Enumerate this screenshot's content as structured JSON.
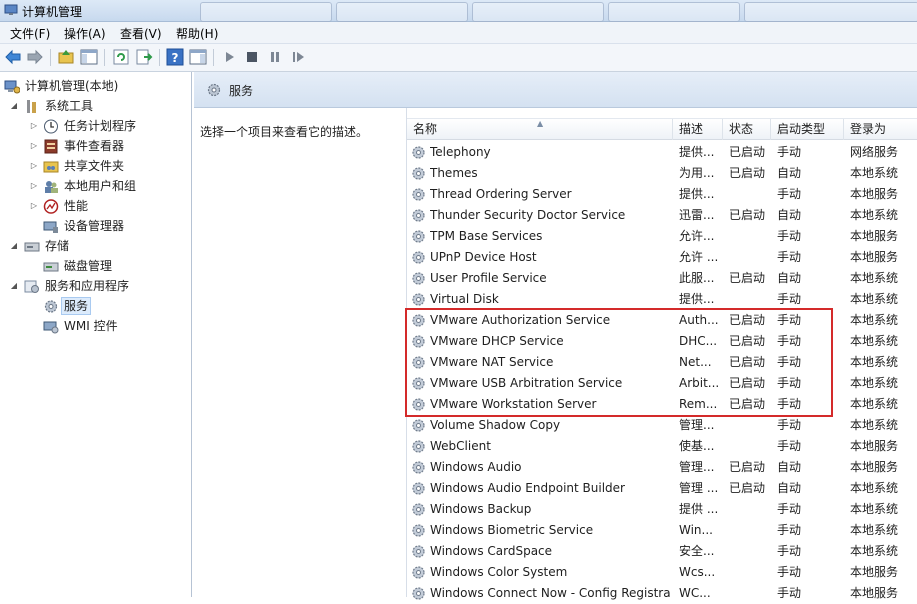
{
  "window": {
    "title": "计算机管理"
  },
  "menu": [
    "文件(F)",
    "操作(A)",
    "查看(V)",
    "帮助(H)"
  ],
  "tree": {
    "root": "计算机管理(本地)",
    "system_tools": "系统工具",
    "task_scheduler": "任务计划程序",
    "event_viewer": "事件查看器",
    "shared_folders": "共享文件夹",
    "local_users": "本地用户和组",
    "performance": "性能",
    "device_manager": "设备管理器",
    "storage": "存储",
    "disk_management": "磁盘管理",
    "services_apps": "服务和应用程序",
    "services": "服务",
    "wmi": "WMI 控件"
  },
  "main": {
    "header_title": "服务",
    "description_prompt": "选择一个项目来查看它的描述。"
  },
  "columns": {
    "name": "名称",
    "description": "描述",
    "status": "状态",
    "startup": "启动类型",
    "logon": "登录为"
  },
  "services": [
    {
      "name": "Telephony",
      "desc": "提供...",
      "status": "已启动",
      "startup": "手动",
      "logon": "网络服务"
    },
    {
      "name": "Themes",
      "desc": "为用...",
      "status": "已启动",
      "startup": "自动",
      "logon": "本地系统"
    },
    {
      "name": "Thread Ordering Server",
      "desc": "提供...",
      "status": "",
      "startup": "手动",
      "logon": "本地服务"
    },
    {
      "name": "Thunder Security Doctor Service",
      "desc": "迅雷...",
      "status": "已启动",
      "startup": "自动",
      "logon": "本地系统"
    },
    {
      "name": "TPM Base Services",
      "desc": "允许...",
      "status": "",
      "startup": "手动",
      "logon": "本地服务"
    },
    {
      "name": "UPnP Device Host",
      "desc": "允许 ...",
      "status": "",
      "startup": "手动",
      "logon": "本地服务"
    },
    {
      "name": "User Profile Service",
      "desc": "此服...",
      "status": "已启动",
      "startup": "自动",
      "logon": "本地系统"
    },
    {
      "name": "Virtual Disk",
      "desc": "提供...",
      "status": "",
      "startup": "手动",
      "logon": "本地系统"
    },
    {
      "name": "VMware Authorization Service",
      "desc": "Auth...",
      "status": "已启动",
      "startup": "手动",
      "logon": "本地系统"
    },
    {
      "name": "VMware DHCP Service",
      "desc": "DHC...",
      "status": "已启动",
      "startup": "手动",
      "logon": "本地系统"
    },
    {
      "name": "VMware NAT Service",
      "desc": "Net...",
      "status": "已启动",
      "startup": "手动",
      "logon": "本地系统"
    },
    {
      "name": "VMware USB Arbitration Service",
      "desc": "Arbit...",
      "status": "已启动",
      "startup": "手动",
      "logon": "本地系统"
    },
    {
      "name": "VMware Workstation Server",
      "desc": "Rem...",
      "status": "已启动",
      "startup": "手动",
      "logon": "本地系统"
    },
    {
      "name": "Volume Shadow Copy",
      "desc": "管理...",
      "status": "",
      "startup": "手动",
      "logon": "本地系统"
    },
    {
      "name": "WebClient",
      "desc": "使基...",
      "status": "",
      "startup": "手动",
      "logon": "本地服务"
    },
    {
      "name": "Windows Audio",
      "desc": "管理...",
      "status": "已启动",
      "startup": "自动",
      "logon": "本地服务"
    },
    {
      "name": "Windows Audio Endpoint Builder",
      "desc": "管理 ...",
      "status": "已启动",
      "startup": "自动",
      "logon": "本地系统"
    },
    {
      "name": "Windows Backup",
      "desc": "提供 ...",
      "status": "",
      "startup": "手动",
      "logon": "本地系统"
    },
    {
      "name": "Windows Biometric Service",
      "desc": "Win...",
      "status": "",
      "startup": "手动",
      "logon": "本地系统"
    },
    {
      "name": "Windows CardSpace",
      "desc": "安全...",
      "status": "",
      "startup": "手动",
      "logon": "本地系统"
    },
    {
      "name": "Windows Color System",
      "desc": "Wcs...",
      "status": "",
      "startup": "手动",
      "logon": "本地服务"
    },
    {
      "name": "Windows Connect Now - Config Registrar",
      "desc": "WC...",
      "status": "",
      "startup": "手动",
      "logon": "本地服务"
    }
  ],
  "colors": {
    "highlight_box": "#d42a2a",
    "header_gradient_top": "#e6eef8",
    "selection": "#dcebfc"
  },
  "icons": {
    "toolbar": [
      "back-arrow-icon",
      "forward-arrow-icon",
      "up-folder-icon",
      "show-hide-tree-icon",
      "refresh-icon",
      "export-list-icon",
      "help-icon",
      "action-pane-icon",
      "start-service-icon",
      "stop-service-icon",
      "pause-service-icon",
      "resume-service-icon"
    ],
    "service": "gear-icon"
  }
}
